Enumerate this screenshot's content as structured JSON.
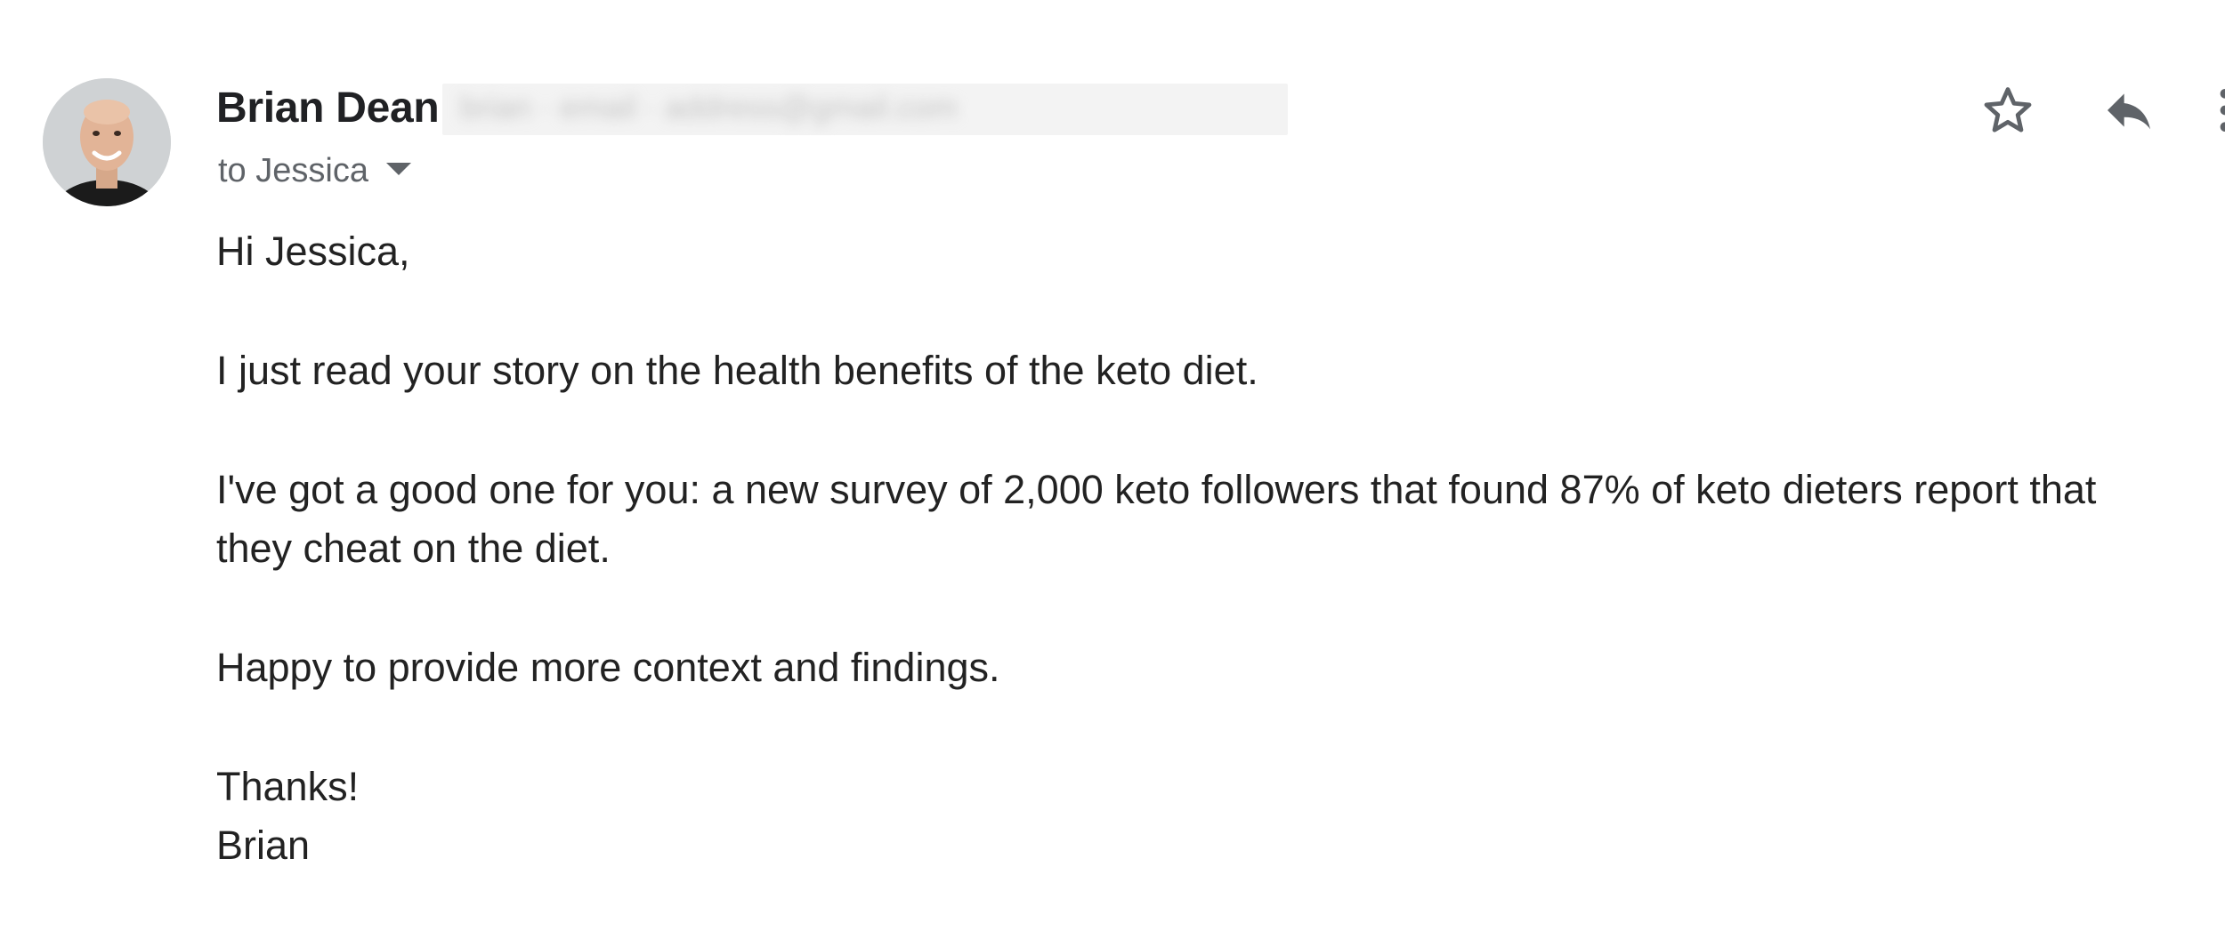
{
  "email": {
    "sender": {
      "name": "Brian Dean",
      "email_redacted": "brian · email · address@gmail.com"
    },
    "recipient": {
      "label": "to Jessica"
    },
    "actions": {
      "star": "star-icon",
      "reply": "reply-icon",
      "more": "more-vert-icon"
    },
    "body": {
      "greeting": "Hi Jessica,",
      "paragraph_1": "I just read your story on the health benefits of the keto diet.",
      "paragraph_2": "I've got a good one for you: a new survey of 2,000 keto followers that found 87% of keto dieters report that they cheat on the diet.",
      "paragraph_3": "Happy to provide more context and findings.",
      "closing": "Thanks!",
      "signature": "Brian"
    }
  },
  "colors": {
    "icon": "#5f6368",
    "text": "#222222",
    "redaction": "#f3f3f3"
  }
}
